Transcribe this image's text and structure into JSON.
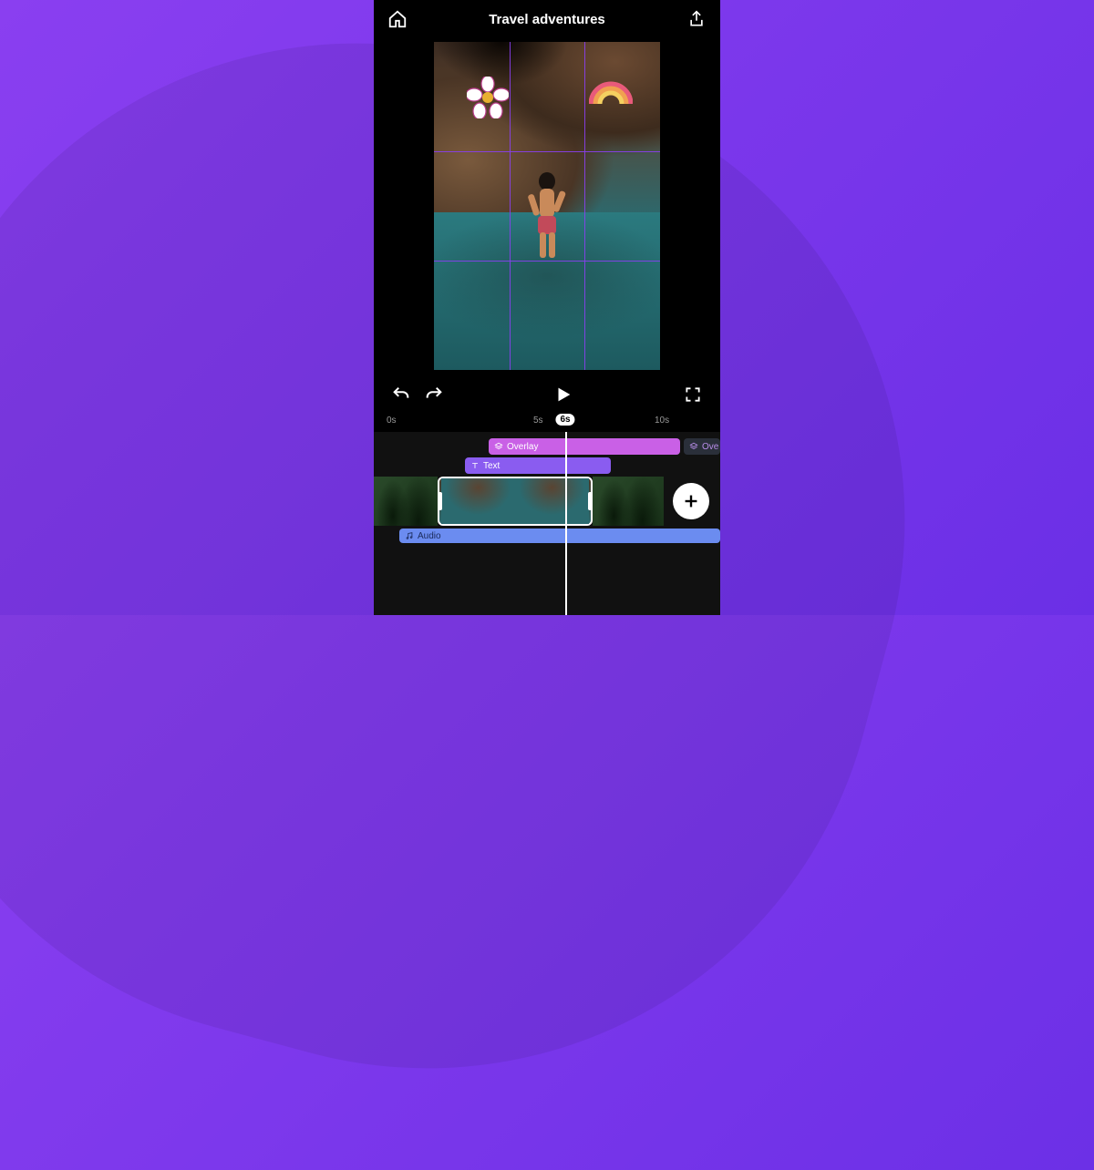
{
  "header": {
    "title": "Travel adventures"
  },
  "ruler": {
    "marks": [
      "0s",
      "5s",
      "10s"
    ],
    "playhead": "6s"
  },
  "tracks": {
    "overlay1_label": "Overlay",
    "overlay2_label": "Ove",
    "text_label": "Text",
    "audio_label": "Audio"
  },
  "colors": {
    "accent": "#8a3ff0",
    "overlay": "#c960e6",
    "text_track": "#8a5cf0",
    "audio_track": "#6b8cf0"
  },
  "stickers": {
    "preview_sticker_1": "flower",
    "preview_sticker_2": "rainbow"
  }
}
